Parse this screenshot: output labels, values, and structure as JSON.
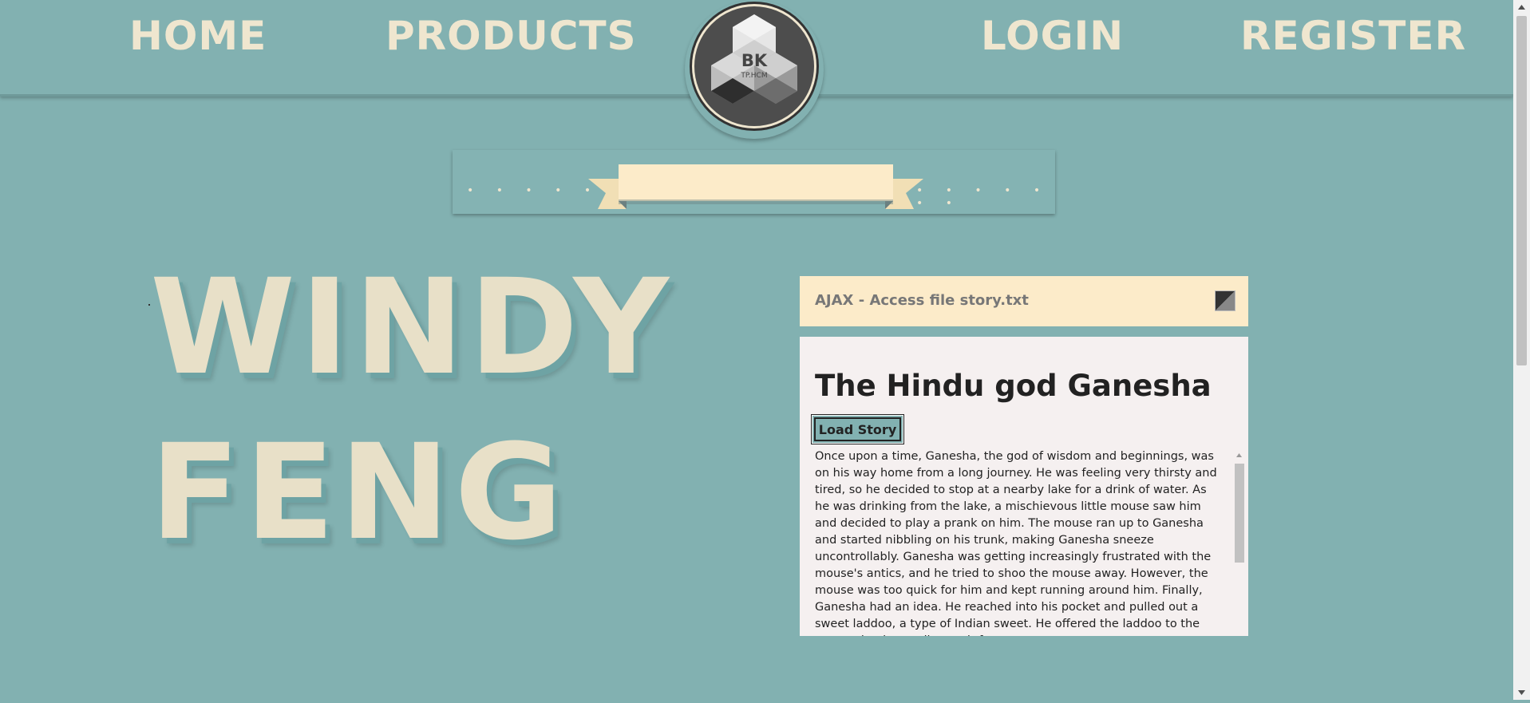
{
  "nav": {
    "home": "HOME",
    "products": "PRODUCTS",
    "login": "LOGIN",
    "register": "REGISTER"
  },
  "logo": {
    "main": "BK",
    "sub": "TP.HCM"
  },
  "hero": {
    "line1": "WINDY",
    "line2": "FENG"
  },
  "panel": {
    "title": "AJAX - Access file story.txt",
    "heading": "The Hindu god Ganesha",
    "button_label": "Load Story",
    "story": "Once upon a time, Ganesha, the god of wisdom and beginnings, was on his way home from a long journey. He was feeling very thirsty and tired, so he decided to stop at a nearby lake for a drink of water. As he was drinking from the lake, a mischievous little mouse saw him and decided to play a prank on him. The mouse ran up to Ganesha and started nibbling on his trunk, making Ganesha sneeze uncontrollably. Ganesha was getting increasingly frustrated with the mouse's antics, and he tried to shoo the mouse away. However, the mouse was too quick for him and kept running around him. Finally, Ganesha had an idea. He reached into his pocket and pulled out a sweet laddoo, a type of Indian sweet. He offered the laddoo to the mouse, hoping to distract it from"
  },
  "colors": {
    "background": "#82b1b1",
    "cream": "#efe6cf",
    "panel_header": "#fcebc9",
    "panel_body": "#f5f0f0"
  }
}
